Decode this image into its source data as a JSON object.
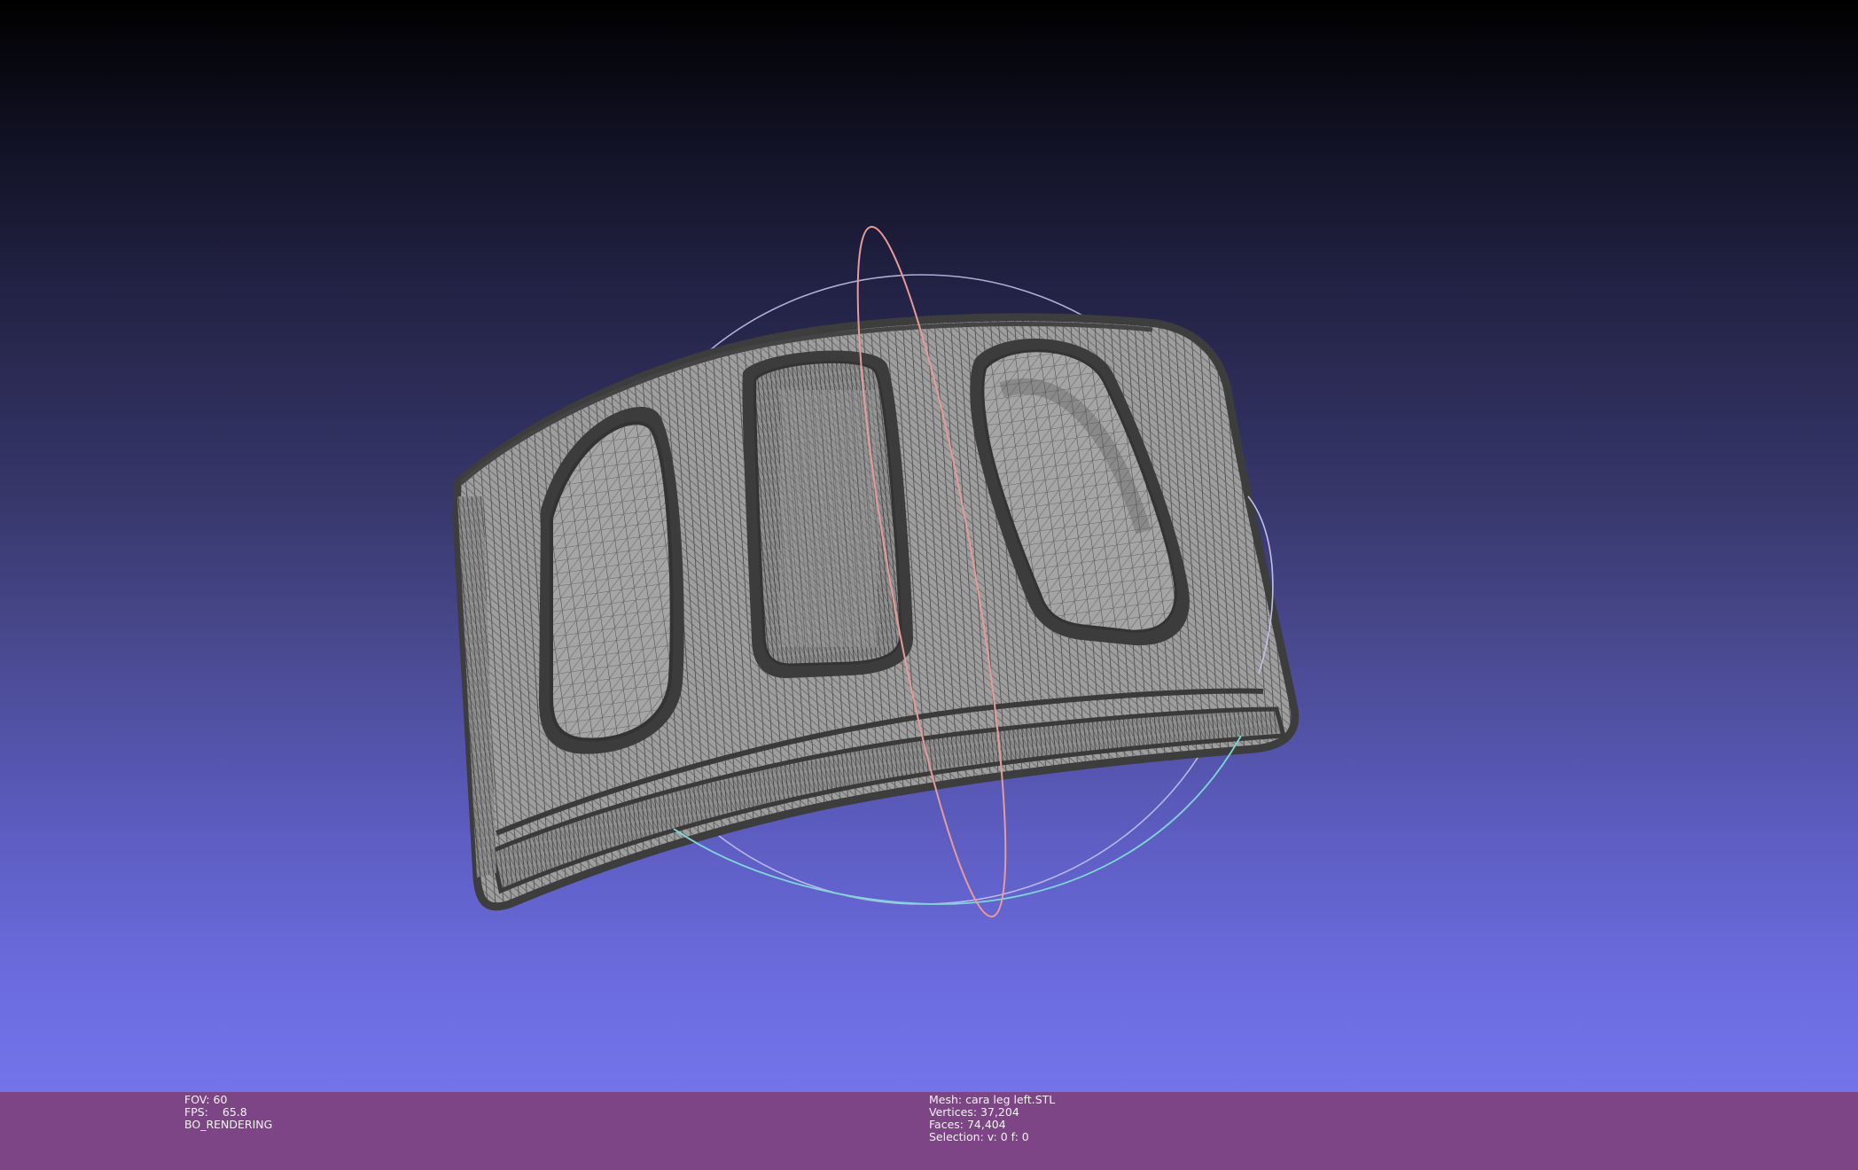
{
  "viewport": {
    "background_top": "#000000",
    "background_bottom": "#7474ea",
    "mesh_wire_color": "#4a4a4a",
    "mesh_fill_color": "#a9a9a9",
    "trackball_colors": {
      "horizontal_ring": "#7fd6d6",
      "vertical_ring": "#e79a9a",
      "side_ring": "#c8c8f0"
    }
  },
  "status_bar": {
    "background": "#7d4585",
    "left": {
      "fov_label": "FOV: 60",
      "fps_label": "FPS:",
      "fps_value": "65.8",
      "render_mode": "BO_RENDERING"
    },
    "right": {
      "mesh_label": "Mesh: cara leg left.STL",
      "vertices_label": "Vertices: 37,204",
      "faces_label": "Faces: 74,404",
      "selection_label": "Selection: v: 0 f: 0"
    }
  }
}
